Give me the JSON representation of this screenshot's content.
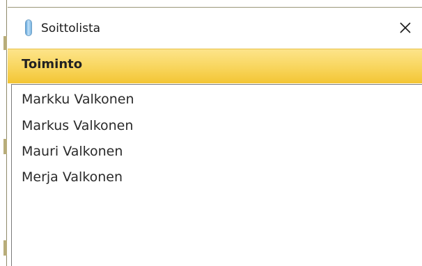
{
  "window": {
    "title": "Soittolista",
    "app_icon": "vertical-capsule-icon",
    "close_icon": "close-icon"
  },
  "menubar": {
    "items": [
      {
        "label": "Toiminto"
      }
    ]
  },
  "list": {
    "items": [
      {
        "label": "Markku Valkonen"
      },
      {
        "label": "Markus Valkonen"
      },
      {
        "label": "Mauri Valkonen"
      },
      {
        "label": "Merja Valkonen"
      }
    ]
  },
  "colors": {
    "menubar_top": "#fde48a",
    "menubar_bottom": "#f3c534",
    "frame": "#8e8a6a"
  }
}
